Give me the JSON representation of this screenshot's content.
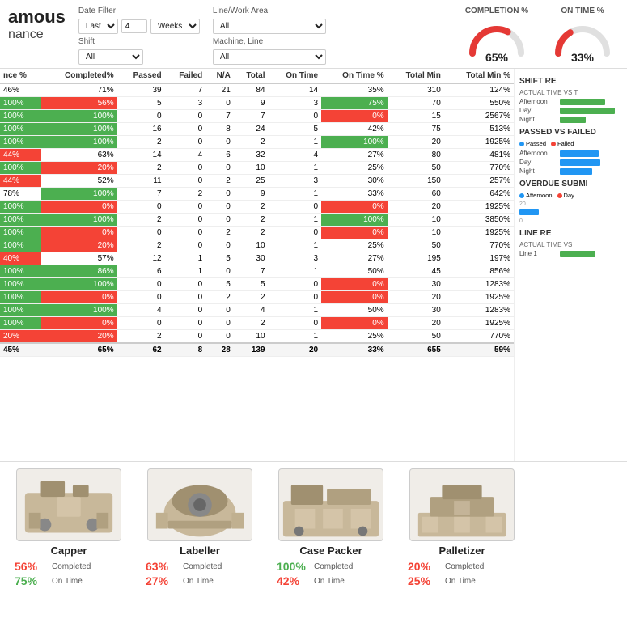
{
  "header": {
    "title1": "amous",
    "title2": "nance",
    "date_filter_label": "Date Filter",
    "date_filter_value": "Last",
    "date_number": "4",
    "date_unit": "Weeks",
    "shift_label": "Shift",
    "shift_value": "All",
    "line_area_label": "Line/Work Area",
    "line_area_value": "All",
    "machine_line_label": "Machine, Line",
    "machine_line_value": "All",
    "completion_label": "COMPLETION %",
    "completion_value": "65%",
    "completion_pct": 65,
    "ontime_label": "ON TIME %",
    "ontime_value": "33%",
    "ontime_pct": 33
  },
  "table": {
    "columns": [
      "nce %",
      "Completed%",
      "Passed",
      "Failed",
      "N/A",
      "Total",
      "On Time",
      "On Time %",
      "Total Min",
      "Total Min %"
    ],
    "rows": [
      {
        "nce": "46%",
        "completed": "71%",
        "passed": 39,
        "failed": 7,
        "na": 21,
        "total": 84,
        "ontime": 14,
        "ontime_pct": "35%",
        "total_min": 310,
        "total_min_pct": "124%",
        "completed_color": "",
        "nce_color": ""
      },
      {
        "nce": "100%",
        "completed": "56%",
        "passed": 5,
        "failed": 3,
        "na": 0,
        "total": 9,
        "ontime": 3,
        "ontime_pct": "75%",
        "total_min": 70,
        "total_min_pct": "550%",
        "completed_color": "red",
        "nce_color": "green",
        "ontime_color": "green"
      },
      {
        "nce": "100%",
        "completed": "100%",
        "passed": 0,
        "failed": 0,
        "na": 7,
        "total": 7,
        "ontime": 0,
        "ontime_pct": "0%",
        "total_min": 15,
        "total_min_pct": "2567%",
        "completed_color": "green",
        "nce_color": "green",
        "ontime_color": "red"
      },
      {
        "nce": "100%",
        "completed": "100%",
        "passed": 16,
        "failed": 0,
        "na": 8,
        "total": 24,
        "ontime": 5,
        "ontime_pct": "42%",
        "total_min": 75,
        "total_min_pct": "513%",
        "completed_color": "green",
        "nce_color": "green"
      },
      {
        "nce": "100%",
        "completed": "100%",
        "passed": 2,
        "failed": 0,
        "na": 0,
        "total": 2,
        "ontime": 1,
        "ontime_pct": "100%",
        "total_min": 20,
        "total_min_pct": "1925%",
        "completed_color": "green",
        "nce_color": "green",
        "ontime_color": "green"
      },
      {
        "nce": "44%",
        "completed": "63%",
        "passed": 14,
        "failed": 4,
        "na": 6,
        "total": 32,
        "ontime": 4,
        "ontime_pct": "27%",
        "total_min": 80,
        "total_min_pct": "481%",
        "completed_color": "",
        "nce_color": "red"
      },
      {
        "nce": "100%",
        "completed": "20%",
        "passed": 2,
        "failed": 0,
        "na": 0,
        "total": 10,
        "ontime": 1,
        "ontime_pct": "25%",
        "total_min": 50,
        "total_min_pct": "770%",
        "completed_color": "red",
        "nce_color": "green"
      },
      {
        "nce": "44%",
        "completed": "52%",
        "passed": 11,
        "failed": 0,
        "na": 2,
        "total": 25,
        "ontime": 3,
        "ontime_pct": "30%",
        "total_min": 150,
        "total_min_pct": "257%",
        "completed_color": "",
        "nce_color": "red"
      },
      {
        "nce": "78%",
        "completed": "100%",
        "passed": 7,
        "failed": 2,
        "na": 0,
        "total": 9,
        "ontime": 1,
        "ontime_pct": "33%",
        "total_min": 60,
        "total_min_pct": "642%",
        "completed_color": "green",
        "nce_color": ""
      },
      {
        "nce": "100%",
        "completed": "0%",
        "passed": 0,
        "failed": 0,
        "na": 0,
        "total": 2,
        "ontime": 0,
        "ontime_pct": "0%",
        "total_min": 20,
        "total_min_pct": "1925%",
        "completed_color": "red",
        "nce_color": "green",
        "ontime_color": "red"
      },
      {
        "nce": "100%",
        "completed": "100%",
        "passed": 2,
        "failed": 0,
        "na": 0,
        "total": 2,
        "ontime": 1,
        "ontime_pct": "100%",
        "total_min": 10,
        "total_min_pct": "3850%",
        "completed_color": "green",
        "nce_color": "green",
        "ontime_color": "green"
      },
      {
        "nce": "100%",
        "completed": "0%",
        "passed": 0,
        "failed": 0,
        "na": 2,
        "total": 2,
        "ontime": 0,
        "ontime_pct": "0%",
        "total_min": 10,
        "total_min_pct": "1925%",
        "completed_color": "red",
        "nce_color": "green",
        "ontime_color": "red"
      },
      {
        "nce": "100%",
        "completed": "20%",
        "passed": 2,
        "failed": 0,
        "na": 0,
        "total": 10,
        "ontime": 1,
        "ontime_pct": "25%",
        "total_min": 50,
        "total_min_pct": "770%",
        "completed_color": "red",
        "nce_color": "green"
      },
      {
        "nce": "40%",
        "completed": "57%",
        "passed": 12,
        "failed": 1,
        "na": 5,
        "total": 30,
        "ontime": 3,
        "ontime_pct": "27%",
        "total_min": 195,
        "total_min_pct": "197%",
        "completed_color": "",
        "nce_color": "red"
      },
      {
        "nce": "100%",
        "completed": "86%",
        "passed": 6,
        "failed": 1,
        "na": 0,
        "total": 7,
        "ontime": 1,
        "ontime_pct": "50%",
        "total_min": 45,
        "total_min_pct": "856%",
        "completed_color": "green",
        "nce_color": "green"
      },
      {
        "nce": "100%",
        "completed": "100%",
        "passed": 0,
        "failed": 0,
        "na": 5,
        "total": 5,
        "ontime": 0,
        "ontime_pct": "0%",
        "total_min": 30,
        "total_min_pct": "1283%",
        "completed_color": "green",
        "nce_color": "green",
        "ontime_color": "red"
      },
      {
        "nce": "100%",
        "completed": "0%",
        "passed": 0,
        "failed": 0,
        "na": 2,
        "total": 2,
        "ontime": 0,
        "ontime_pct": "0%",
        "total_min": 20,
        "total_min_pct": "1925%",
        "completed_color": "red",
        "nce_color": "green",
        "ontime_color": "red"
      },
      {
        "nce": "100%",
        "completed": "100%",
        "passed": 4,
        "failed": 0,
        "na": 0,
        "total": 4,
        "ontime": 1,
        "ontime_pct": "50%",
        "total_min": 30,
        "total_min_pct": "1283%",
        "completed_color": "green",
        "nce_color": "green"
      },
      {
        "nce": "100%",
        "completed": "0%",
        "passed": 0,
        "failed": 0,
        "na": 0,
        "total": 2,
        "ontime": 0,
        "ontime_pct": "0%",
        "total_min": 20,
        "total_min_pct": "1925%",
        "completed_color": "red",
        "nce_color": "green",
        "ontime_color": "red"
      },
      {
        "nce": "20%",
        "completed": "20%",
        "passed": 2,
        "failed": 0,
        "na": 0,
        "total": 10,
        "ontime": 1,
        "ontime_pct": "25%",
        "total_min": 50,
        "total_min_pct": "770%",
        "completed_color": "red",
        "nce_color": "red"
      }
    ],
    "summary": {
      "nce": "45%",
      "completed": "65%",
      "passed": 62,
      "failed": 8,
      "na": 28,
      "total": 139,
      "ontime": 20,
      "ontime_pct": "33%",
      "total_min": 655,
      "total_min_pct": "59%"
    }
  },
  "right_panel": {
    "shift_report_title": "SHIFT RE",
    "actual_time_title": "ACTUAL TIME VS T",
    "passed_failed_title": "PASSED VS FAILED",
    "overdue_title": "OVERDUE SUBMI",
    "line_report_title": "LINE RE",
    "line_actual_title": "ACTUAL TIME VS",
    "legend_passed": "Passed",
    "legend_failed": "Failed",
    "legend_afternoon": "Afternoon",
    "legend_day": "Day",
    "legend_night": "Night",
    "bars_actual": [
      {
        "label": "Afternoon",
        "value": 70
      },
      {
        "label": "Day",
        "value": 85
      },
      {
        "label": "Night",
        "value": 40
      }
    ],
    "bars_passed": [
      {
        "label": "Afternoon",
        "value": 60
      },
      {
        "label": "Day",
        "value": 75
      },
      {
        "label": "Night",
        "value": 50
      }
    ],
    "bars_overdue": [
      {
        "value": 30
      }
    ],
    "line_bars": [
      {
        "label": "Line 1",
        "value": 55
      }
    ]
  },
  "machines": [
    {
      "name": "Capper",
      "completed_pct": "56%",
      "completed_label": "Completed",
      "ontime_pct": "75%",
      "ontime_label": "On Time",
      "completed_color": "red",
      "ontime_color": "green"
    },
    {
      "name": "Labeller",
      "completed_pct": "63%",
      "completed_label": "Completed",
      "ontime_pct": "27%",
      "ontime_label": "On Time",
      "completed_color": "red",
      "ontime_color": "red"
    },
    {
      "name": "Case Packer",
      "completed_pct": "100%",
      "completed_label": "Completed",
      "ontime_pct": "42%",
      "ontime_label": "On Time",
      "completed_color": "green",
      "ontime_color": "red"
    },
    {
      "name": "Palletizer",
      "completed_pct": "20%",
      "completed_label": "Completed",
      "ontime_pct": "25%",
      "ontime_label": "On Time",
      "completed_color": "red",
      "ontime_color": "red"
    }
  ]
}
